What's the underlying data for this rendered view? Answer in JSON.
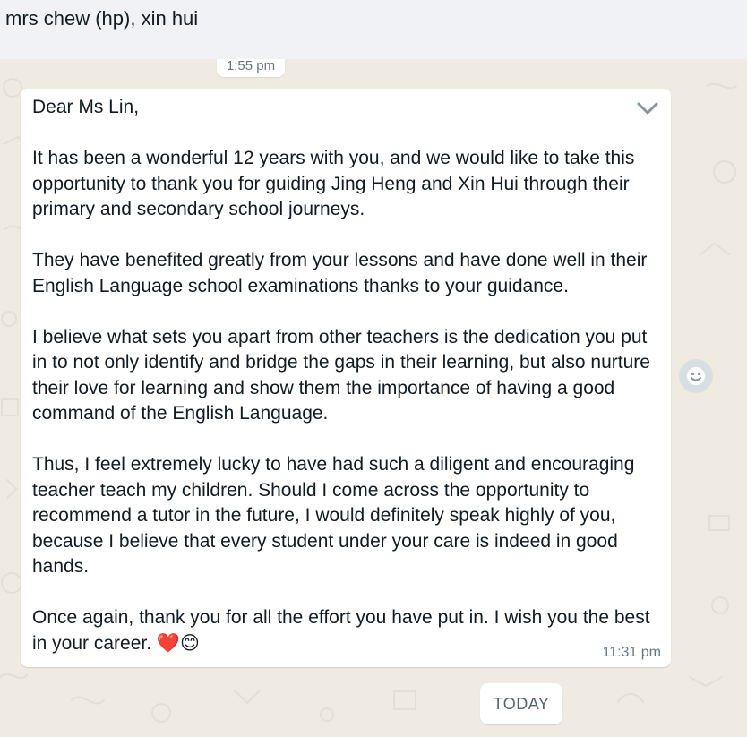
{
  "chat": {
    "title": "mrs chew (hp), xin hui",
    "top_time": "1:55 pm",
    "date_divider": "TODAY"
  },
  "message": {
    "text": "Dear Ms Lin,\n\nIt has been a wonderful 12 years with you, and we would like to take this opportunity to thank you for guiding Jing Heng and Xin Hui through their primary and secondary school journeys.\n\nThey have benefited greatly from your lessons and have done well in their English Language school examinations thanks to your guidance.\n\nI believe what sets you apart from other teachers is the dedication you put in to not only identify and bridge the gaps in their learning, but also nurture their love for learning and show them the importance of having a good command of the English Language.\n\nThus, I feel extremely lucky to have had such a diligent and encouraging teacher teach my children. Should I come across the opportunity to recommend a tutor in the future, I would definitely speak highly of you, because I believe that every student under your care is indeed in good hands.\n\nOnce again, thank you for all the effort you have put in. I wish you the best in your career. ❤️😊",
    "time": "11:31 pm"
  },
  "icons": {
    "dropdown": "chevron-down-icon",
    "reaction": "smiley-reaction-icon"
  },
  "colors": {
    "chat_background": "#efeae2",
    "header_background": "#f0f2f5",
    "message_background": "#ffffff",
    "secondary_text": "#667781"
  }
}
